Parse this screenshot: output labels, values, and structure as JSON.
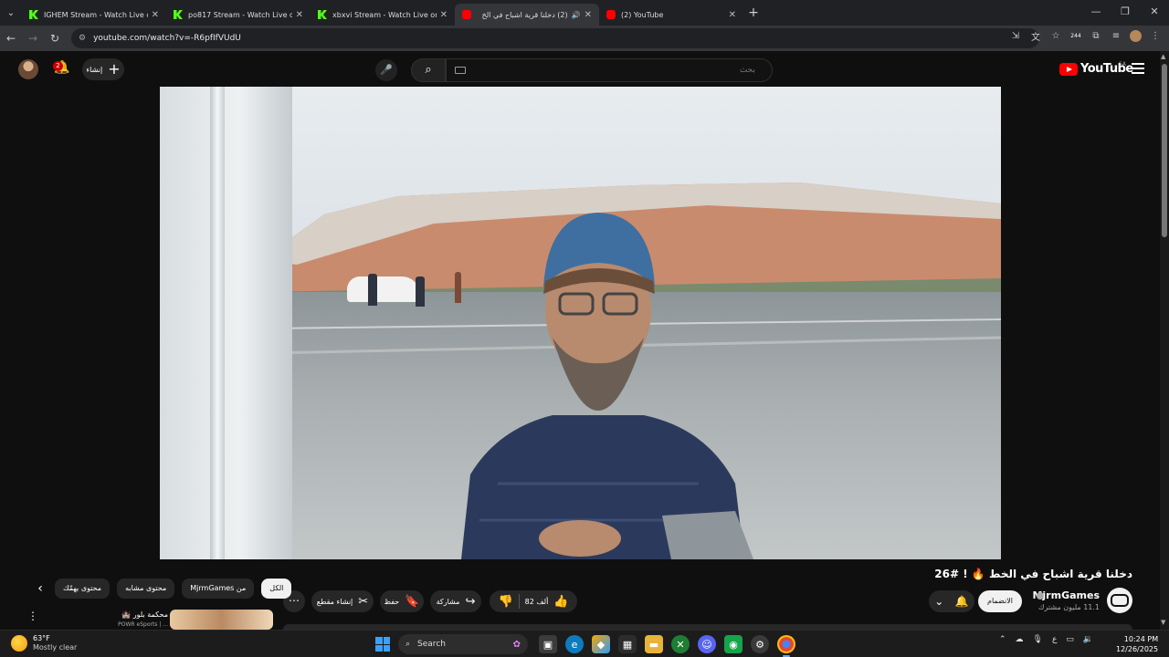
{
  "browser": {
    "tabs": [
      {
        "title": "IGHEM Stream - Watch Live on",
        "favicon": "kick-icon",
        "active": false
      },
      {
        "title": "po817 Stream - Watch Live on K",
        "favicon": "kick-icon",
        "active": false
      },
      {
        "title": "xbxvi Stream - Watch Live on Ki",
        "favicon": "kick-icon",
        "active": false
      },
      {
        "title": "(2) دخلنا قرية اشباح في الخ",
        "favicon": "youtube-icon",
        "active": true
      },
      {
        "title": "(2) YouTube",
        "favicon": "youtube-icon",
        "active": false
      }
    ],
    "url": "youtube.com/watch?v=-R6pfIfVUdU",
    "extension_badge": "244"
  },
  "youtube": {
    "notification_count": "2",
    "create_label": "إنشاء",
    "search_placeholder": "بحث",
    "logo_text": "YouTube",
    "region": "SA",
    "video": {
      "title": "دخلنا قرية اشباح في الخط 🔥 ! #26",
      "channel_name": "MjrmGames",
      "subscribers": "11.1 مليون مشترك",
      "join_label": "الانضمام",
      "like_count": "82 ألف",
      "share_label": "مشاركة",
      "save_label": "حفظ",
      "clip_label": "إنشاء مقطع"
    },
    "chips": [
      {
        "label": "الكل",
        "selected": true
      },
      {
        "label": "من MjrmGames",
        "selected": false
      },
      {
        "label": "محتوى مشابه",
        "selected": false
      },
      {
        "label": "محتوى يهمّك",
        "selected": false
      }
    ],
    "recommendation": {
      "title": "محكمة بلور 🏰",
      "subtitle": "POWR eSports | ..."
    }
  },
  "taskbar": {
    "temperature": "63°F",
    "weather": "Mostly clear",
    "search_label": "Search",
    "language": "ع",
    "time": "10:24 PM",
    "date": "12/26/2025"
  },
  "colors": {
    "youtube_red": "#ff0000",
    "background": "#0f0f0f",
    "kick_green": "#53fc18"
  }
}
